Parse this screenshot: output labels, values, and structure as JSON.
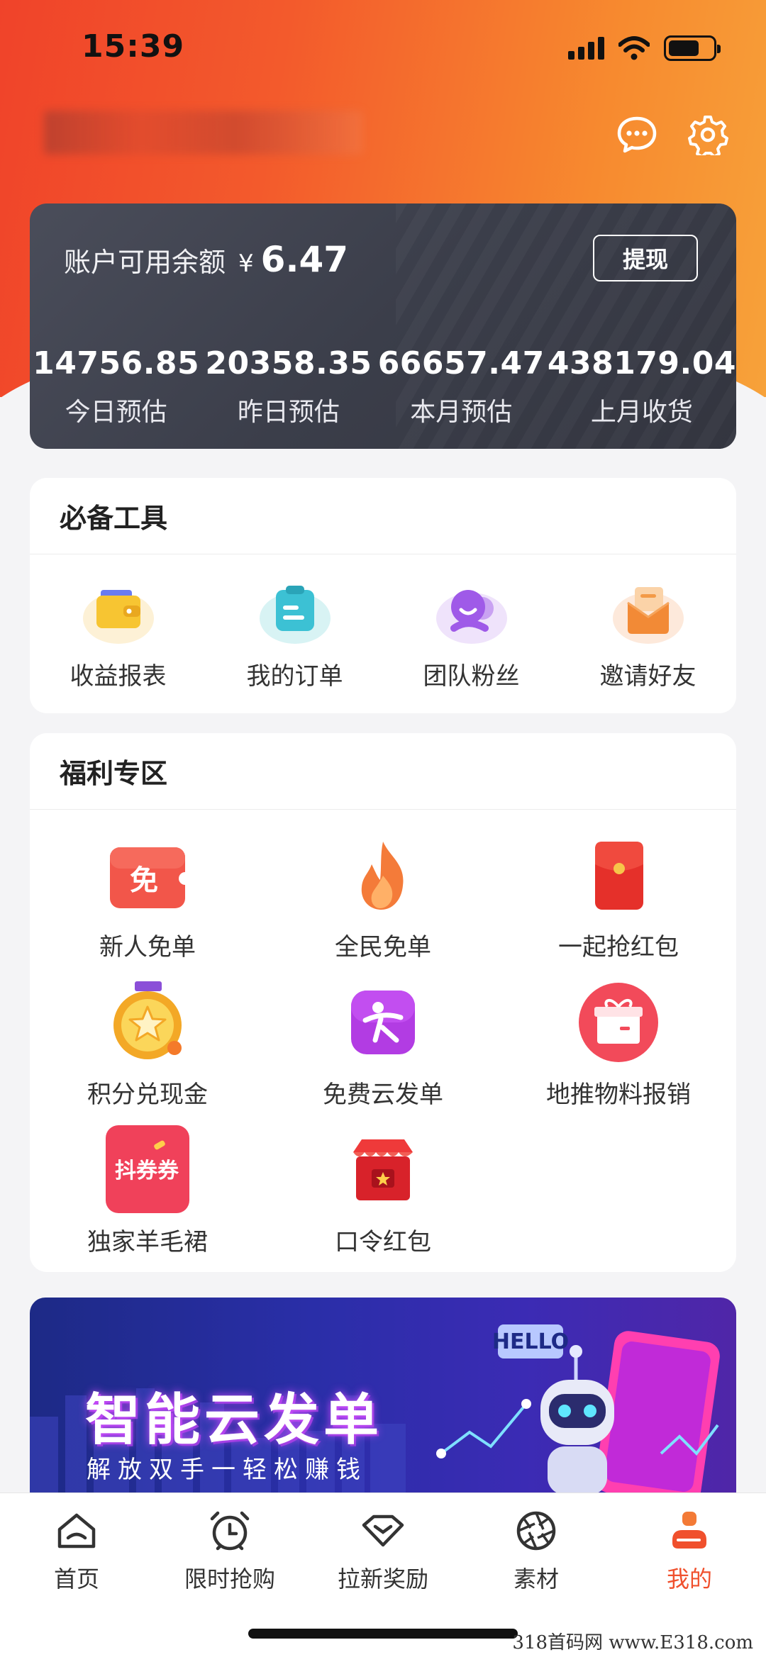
{
  "status_bar": {
    "time": "15:39"
  },
  "header": {
    "message_icon": "chat-bubble-icon",
    "settings_icon": "gear-icon"
  },
  "balance": {
    "label": "账户可用余额",
    "currency": "¥",
    "value": "6.47",
    "withdraw_label": "提现",
    "stats": [
      {
        "value": "14756.85",
        "label": "今日预估"
      },
      {
        "value": "20358.35",
        "label": "昨日预估"
      },
      {
        "value": "66657.47",
        "label": "本月预估"
      },
      {
        "value": "438179.04",
        "label": "上月收货"
      }
    ]
  },
  "tools": {
    "title": "必备工具",
    "items": [
      {
        "label": "收益报表",
        "icon": "wallet-icon"
      },
      {
        "label": "我的订单",
        "icon": "clipboard-icon"
      },
      {
        "label": "团队粉丝",
        "icon": "smiley-group-icon"
      },
      {
        "label": "邀请好友",
        "icon": "envelope-icon"
      }
    ]
  },
  "welfare": {
    "title": "福利专区",
    "items": [
      {
        "label": "新人免单",
        "icon": "free-ticket-icon",
        "icon_text": "免"
      },
      {
        "label": "全民免单",
        "icon": "flame-icon"
      },
      {
        "label": "一起抢红包",
        "icon": "red-envelope-icon"
      },
      {
        "label": "积分兑现金",
        "icon": "star-medal-icon"
      },
      {
        "label": "免费云发单",
        "icon": "running-person-icon"
      },
      {
        "label": "地推物料报销",
        "icon": "gift-box-icon"
      },
      {
        "label": "独家羊毛裙",
        "icon": "coupon-icon",
        "icon_text": "抖券券"
      },
      {
        "label": "口令红包",
        "icon": "shop-red-packet-icon"
      }
    ]
  },
  "banner": {
    "title": "智能云发单",
    "subtitle": "解放双手一轻松赚钱",
    "hello_text": "HELLO"
  },
  "tabbar": {
    "items": [
      {
        "label": "首页",
        "icon": "home-icon",
        "active": false
      },
      {
        "label": "限时抢购",
        "icon": "alarm-clock-icon",
        "active": false
      },
      {
        "label": "拉新奖励",
        "icon": "diamond-icon",
        "active": false
      },
      {
        "label": "素材",
        "icon": "aperture-icon",
        "active": false
      },
      {
        "label": "我的",
        "icon": "profile-icon",
        "active": true
      }
    ]
  },
  "watermark": "318首码网  www.E318.com",
  "colors": {
    "accent": "#f0502d",
    "card_dark": "#3b3e4a",
    "banner": "#2a2ea8"
  }
}
